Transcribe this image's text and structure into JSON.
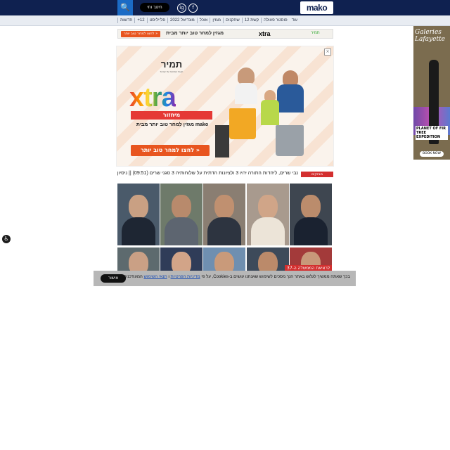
{
  "header": {
    "logo": "mako",
    "live_label": "חינוך וחי",
    "social": [
      "f",
      "ig"
    ]
  },
  "nav": {
    "items": [
      "חדשות",
      "12+",
      "פלייליסט",
      "מונדיאל 2022",
      "אוכל",
      "מגזין",
      "שחקנים",
      "קשת 12",
      "פוסטר פעולה",
      "עוד"
    ]
  },
  "top_banner": {
    "cta": "לחצו למחר טוב יותר »",
    "text": "מגזין למחר טוב יותר מבית",
    "brand": "xtra",
    "brand_sub": "מיחזור",
    "sponsor": "תמיר"
  },
  "big_ad": {
    "sponsor": "תמיר",
    "sponsor_sub": "תאגיד המיחזור של ישראל",
    "brand": "xtra",
    "sub_brand": "מיחזור",
    "tagline": "מגזין למחר טוב יותר מבית mako",
    "cta": "לחצו למחר טוב יותר »",
    "close": "×"
  },
  "right_ad": {
    "headline": "Galeries Lafayette",
    "promo": "PLANET OF FIR TREE EXPEDITION",
    "cta": "BOOK NOW"
  },
  "ticker": {
    "label": "מבזקים",
    "text": "נבי שרים, ליהדות התורה יהיו 3 ולציונות הדתית על שלוחותיה 3 סגני שרים (09:51) || ניסיון"
  },
  "photo_grid": {
    "caption": "לראיאת הממשלה ה-37",
    "tiles_row1": 5,
    "tiles_row2": 5
  },
  "cookie_bar": {
    "ok": "אישור",
    "text_main": "בכך שאתה ממשיך לגלוש באתר הנך מסכים לשימוש שאנחנו עושים ב-Cookies, על פי",
    "link1": "מדיניות הפרטיות",
    "text_and": "ו",
    "link2": "תנאי השימוש",
    "text_end": "המעודכנים."
  },
  "colors": {
    "header_bg": "#0f2150",
    "accent_orange": "#e8551f",
    "news_red": "#d32f2f"
  }
}
